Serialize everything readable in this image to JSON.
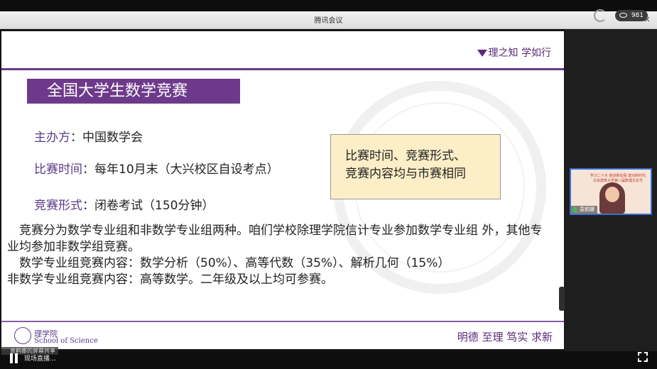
{
  "window": {
    "title": "腾讯会议",
    "viewer_count": "981",
    "close_symbol": "×"
  },
  "slide": {
    "motto_top": "理之知 学如行",
    "title": "全国大学生数学竞赛",
    "rows": [
      {
        "label": "主办方",
        "sep": "：",
        "value": "中国数学会"
      },
      {
        "label": "比赛时间",
        "sep": "：",
        "value": "每年10月末（大兴校区自设考点）"
      },
      {
        "label": "竞赛形式",
        "sep": "：",
        "value": "闭卷考试（150分钟）"
      }
    ],
    "callout": [
      "比赛时间、竞赛形式、",
      "竞赛内容均与市赛相同"
    ],
    "paragraphs": [
      "　竞赛分为数学专业组和非数学专业组两种。咱们学校除理学院信计专业参加数学专业组 外，其他专业均参加非数学组竞赛。",
      "　数学专业组竞赛内容：数学分析（50%）、高等代数（35%）、解析几何（15%）",
      "非数学专业组竞赛内容：高等数学。二年级及以上均可参赛。"
    ],
    "logo_cn": "理学院",
    "logo_en": "School of Science",
    "motto_bottom": "明德 至理 笃实 求新"
  },
  "video": {
    "name": "袁鹤娜",
    "banner_lines": [
      "学习二十大 奋进新征程 建功新时代",
      "北京建筑大学第八届数理文化节"
    ]
  },
  "bottom": {
    "share_label": "袁鹤娜的屏幕共享",
    "live_label": "现场直播..."
  },
  "icons": [
    "refresh-icon",
    "eye-icon",
    "close-icon",
    "pause-icon",
    "fullscreen-icon",
    "mic-icon",
    "school-logo-icon"
  ]
}
